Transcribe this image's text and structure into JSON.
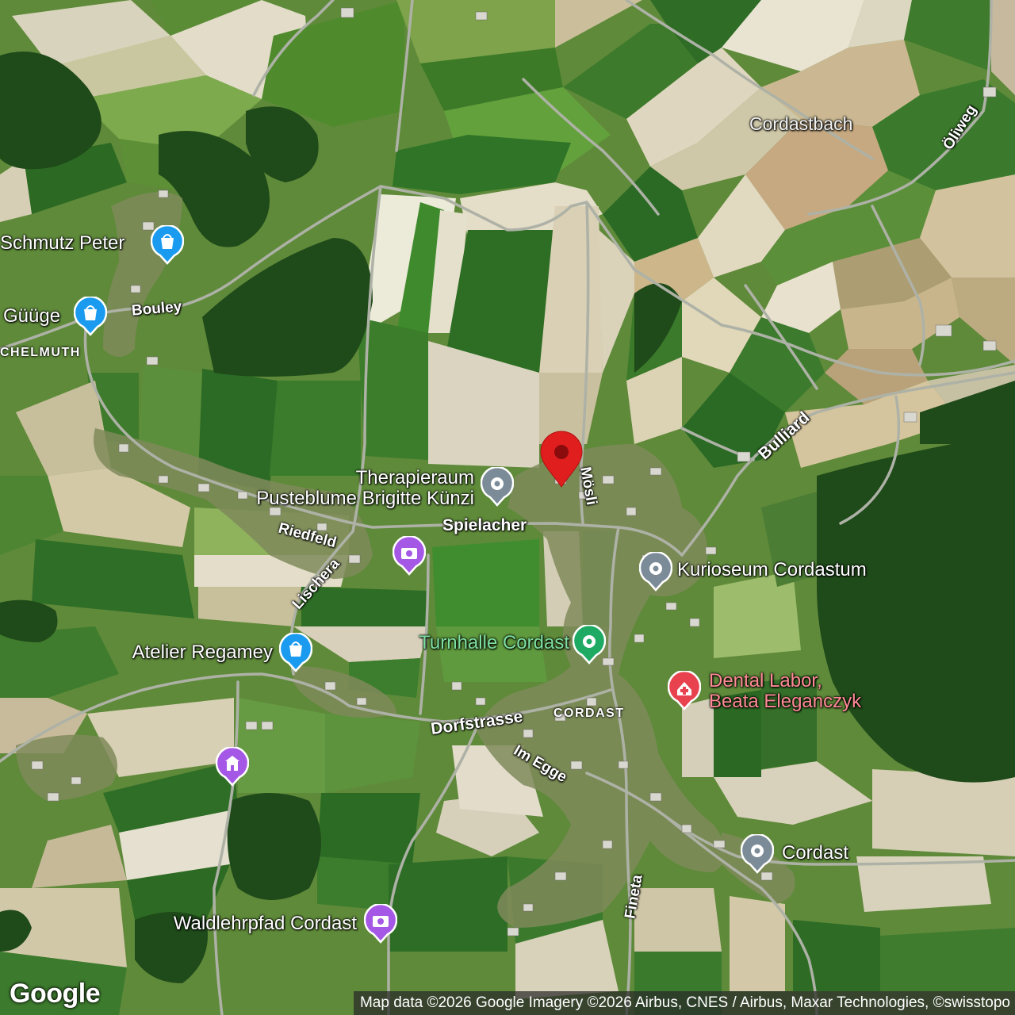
{
  "map": {
    "type": "satellite",
    "brand": "Google",
    "attribution": "Map data ©2026 Google Imagery ©2026 Airbus, CNES / Airbus, Maxar Technologies, ©swisstopo",
    "colors": {
      "shopping": "#1a9bf0",
      "attraction": "#a557e6",
      "generic": "#7b8b97",
      "sport": "#1faa64",
      "medical": "#e8424f",
      "selected_pin": "#e01e1e"
    }
  },
  "areas": {
    "cordast": "CORDAST",
    "helmuth": "CHELMUTH"
  },
  "water": {
    "cordastbach": "Cordastbach"
  },
  "roads": {
    "oliweg": "Öliweg",
    "bouley": "Bouley",
    "bulliard": "Bulliard",
    "mosli": "Mösli",
    "spielacher": "Spielacher",
    "riedfeld": "Riedfeld",
    "lischera": "Lischera",
    "dorfstrasse": "Dorfstrasse",
    "im_egge": "Im Egge",
    "fineta": "Fineta"
  },
  "pois": {
    "schmutz_peter": {
      "name": "Schmutz Peter",
      "icon": "shopping-bag-icon"
    },
    "guuge": {
      "name": "Güüge",
      "icon": "shopping-bag-icon"
    },
    "therapieraum": {
      "name_line1": "Therapieraum",
      "name_line2": "Pusteblume Brigitte Künzi",
      "icon": "location-dot-icon"
    },
    "photo_spot": {
      "icon": "camera-icon"
    },
    "kurioseum": {
      "name": "Kurioseum Cordastum",
      "icon": "location-dot-icon"
    },
    "turnhalle": {
      "name": "Turnhalle Cordast",
      "icon": "location-dot-icon"
    },
    "atelier": {
      "name": "Atelier Regamey",
      "icon": "shopping-bag-icon"
    },
    "dental": {
      "name_line1": "Dental Labor,",
      "name_line2": "Beata Eleganczyk",
      "icon": "medical-cross-icon"
    },
    "monument": {
      "icon": "monument-icon"
    },
    "cordast_stop": {
      "name": "Cordast",
      "icon": "location-dot-icon"
    },
    "waldlehrpfad": {
      "name": "Waldlehrpfad Cordast",
      "icon": "camera-icon"
    }
  }
}
